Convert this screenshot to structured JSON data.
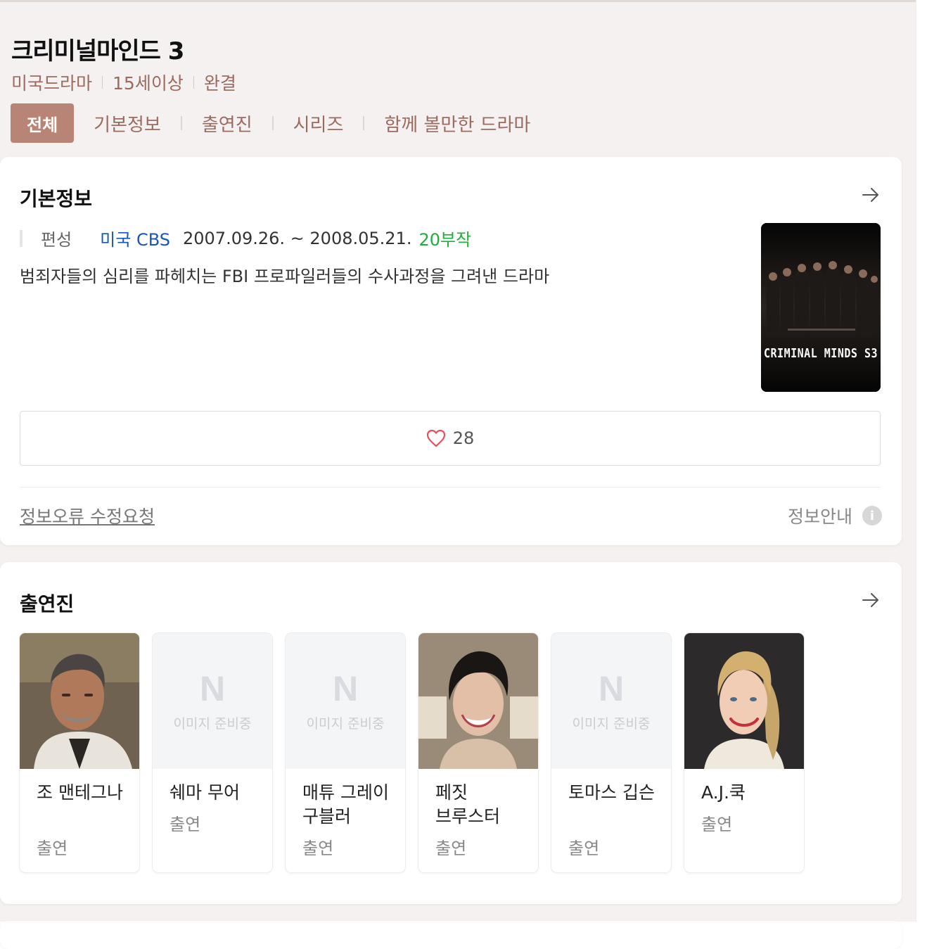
{
  "header": {
    "title": "크리미널마인드 3",
    "meta": [
      "미국드라마",
      "15세이상",
      "완결"
    ]
  },
  "tabs": {
    "active": "전체",
    "items": [
      "기본정보",
      "출연진",
      "시리즈",
      "함께 볼만한 드라마"
    ]
  },
  "basic_info": {
    "title": "기본정보",
    "label": "편성",
    "broadcaster": "미국 CBS",
    "period": "2007.09.26. ~ 2008.05.21.",
    "episodes": "20부작",
    "description": "범죄자들의 심리를 파헤치는 FBI 프로파일러들의 수사과정을 그려낸 드라마",
    "poster_text": "CRIMINAL MINDS S3",
    "likes": "28",
    "report": "정보오류 수정요청",
    "guide": "정보안내"
  },
  "cast": {
    "title": "출연진",
    "placeholder_text": "이미지 준비중",
    "placeholder_logo": "N",
    "members": [
      {
        "name": "조 맨테그나",
        "role": "출연",
        "photo": true
      },
      {
        "name": "쉐마 무어",
        "role": "출연",
        "photo": false
      },
      {
        "name": "매튜 그레이 구블러",
        "role": "출연",
        "photo": false
      },
      {
        "name": "페짓 브루스터",
        "role": "출연",
        "photo": true
      },
      {
        "name": "토마스 깁슨",
        "role": "출연",
        "photo": false
      },
      {
        "name": "A.J.쿡",
        "role": "출연",
        "photo": true
      }
    ]
  },
  "colors": {
    "accent": "#b88476",
    "meta_text": "#9a6b5e",
    "link": "#1a56b8",
    "episodes": "#1fae3a",
    "heart": "#e84f5b"
  }
}
